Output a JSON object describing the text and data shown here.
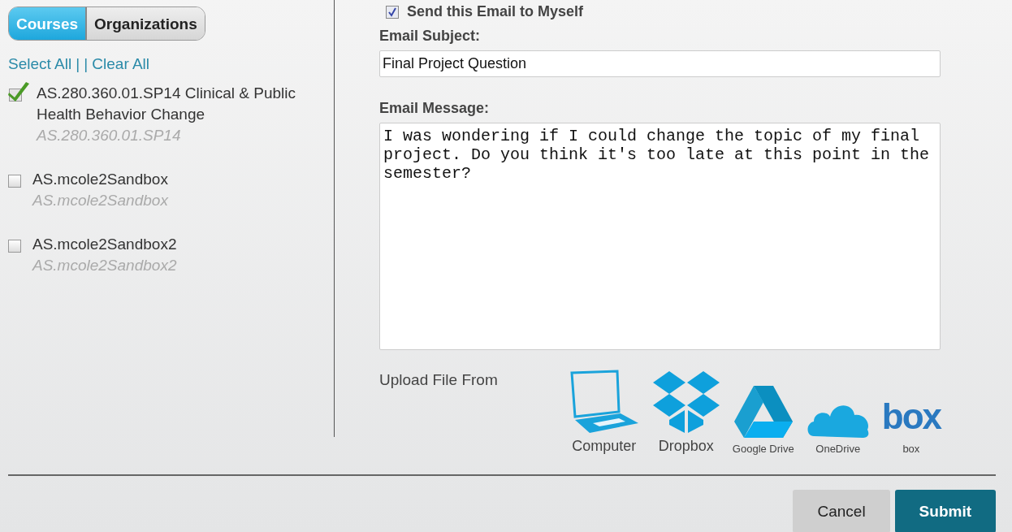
{
  "tabs": [
    {
      "label": "Courses",
      "selected": true
    },
    {
      "label": "Organizations",
      "selected": false
    }
  ],
  "select_all": "Select All",
  "separator": "| |",
  "clear_all": "Clear All",
  "courses": [
    {
      "title": "AS.280.360.01.SP14 Clinical & Public Health Behavior Change",
      "code": "AS.280.360.01.SP14",
      "checked": true
    },
    {
      "title": "AS.mcole2Sandbox",
      "code": "AS.mcole2Sandbox",
      "checked": false
    },
    {
      "title": "AS.mcole2Sandbox2",
      "code": "AS.mcole2Sandbox2",
      "checked": false
    }
  ],
  "send_to_self": {
    "label": "Send this Email to Myself",
    "checked": true
  },
  "subject": {
    "label": "Email Subject:",
    "value": "Final Project Question"
  },
  "message": {
    "label": "Email Message:",
    "value": "I was wondering if I could change the topic of my final project. Do you think it's too late at this point in the semester?"
  },
  "upload": {
    "label": "Upload File From",
    "sources": [
      {
        "kind": "computer",
        "label": "Computer"
      },
      {
        "kind": "dropbox",
        "label": "Dropbox"
      },
      {
        "kind": "drive",
        "label": "Google Drive"
      },
      {
        "kind": "onedrive",
        "label": "OneDrive"
      },
      {
        "kind": "box",
        "logo": "box",
        "label": "box"
      }
    ]
  },
  "buttons": [
    {
      "kind": "cancel",
      "label": "Cancel"
    },
    {
      "kind": "submit",
      "label": "Submit"
    }
  ]
}
